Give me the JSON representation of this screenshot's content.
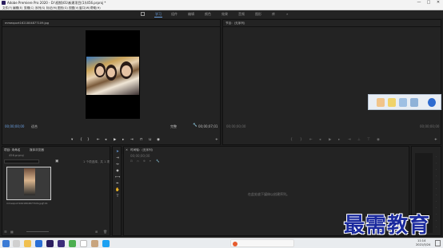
{
  "window": {
    "title": "Adobe Premiere Pro 2020 - D:\\视频\\01\\新建项目(1)\\456.prproj *",
    "controls": [
      "—",
      "□",
      "✕"
    ]
  },
  "menu": [
    "文件(F)",
    "编辑(E)",
    "剪辑(C)",
    "序列(S)",
    "标记(M)",
    "图形(G)",
    "视图(V)",
    "窗口(W)",
    "帮助(H)"
  ],
  "workspaces": [
    "学习",
    "组件",
    "编辑",
    "颜色",
    "效果",
    "音频",
    "图形",
    "库"
  ],
  "workspace_overflow": "»",
  "source": {
    "tab": "mmexport1621804877109.jpg",
    "timecode_in": "00;00;00;00",
    "zoom": "适合",
    "quality": "完整",
    "timecode_out": "00;00;07;01"
  },
  "program": {
    "tab": "节目：(无序列)",
    "timecode_in": "00;00;00;00",
    "timecode_out": "00;00;00;00"
  },
  "project": {
    "tabs": [
      "项目: 未命名",
      "媒体浏览器"
    ],
    "file": "456.prproj",
    "selection_info": "1 个项选择，共 1 项",
    "clip_name": "mmexport1621804877109.jpg",
    "clip_duration": "7;01"
  },
  "timeline": {
    "tab": "时间轴：(无序列)",
    "timecode": "00;00;00;00",
    "empty_message": "在此处放下媒体以创建序列。"
  },
  "taskbar": {
    "time": "11:14",
    "date": "2021/5/24"
  },
  "watermark": "最需教育",
  "colors": {
    "accent": "#6a9fe0",
    "panel_bg": "#232323",
    "watermark": "#1b2a9e"
  }
}
